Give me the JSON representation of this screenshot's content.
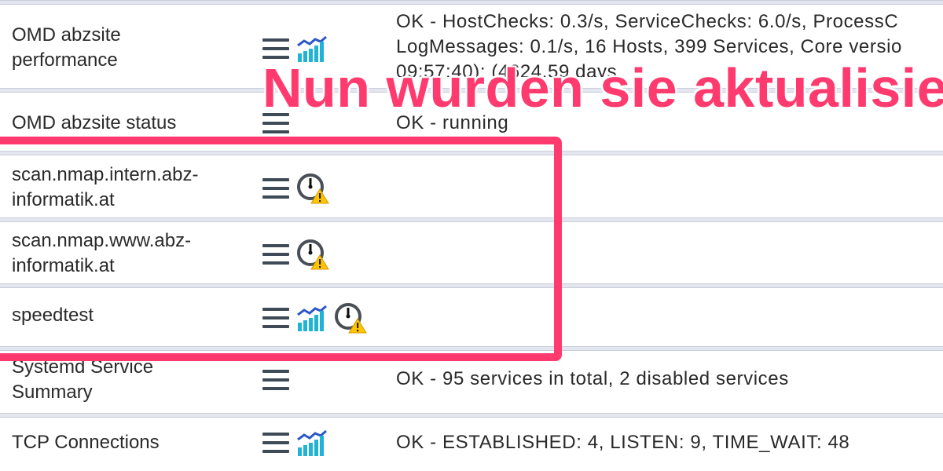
{
  "rows": [
    {
      "service": "OMD abzsite\nperformance",
      "output": "OK - HostChecks: 0.3/s, ServiceChecks: 6.0/s, ProcessC\nLogMessages: 0.1/s, 16 Hosts, 399 Services, Core versio\n09:57:40): (4624.59 days",
      "icons": [
        "menu-icon",
        "perfgraph-icon"
      ]
    },
    {
      "service": "OMD abzsite status",
      "output": "OK - running",
      "icons": [
        "menu-icon"
      ]
    },
    {
      "service": "scan.nmap.intern.abz-\ninformatik.at",
      "output": "",
      "icons": [
        "menu-icon",
        "stale-warning-icon"
      ]
    },
    {
      "service": "scan.nmap.www.abz-\ninformatik.at",
      "output": "",
      "icons": [
        "menu-icon",
        "stale-warning-icon"
      ]
    },
    {
      "service": "speedtest",
      "output": "",
      "icons": [
        "menu-icon",
        "perfgraph-icon",
        "stale-warning-icon"
      ]
    },
    {
      "service": "Systemd Service\nSummary",
      "output": "OK - 95 services in total, 2 disabled services",
      "icons": [
        "menu-icon"
      ]
    },
    {
      "service": "TCP Connections",
      "output": "OK - ESTABLISHED: 4, LISTEN: 9, TIME_WAIT: 48",
      "icons": [
        "menu-icon",
        "perfgraph-icon"
      ]
    }
  ],
  "annotation": {
    "text": "Nun wurden sie aktualisiert",
    "color": "#ff3a6e"
  }
}
